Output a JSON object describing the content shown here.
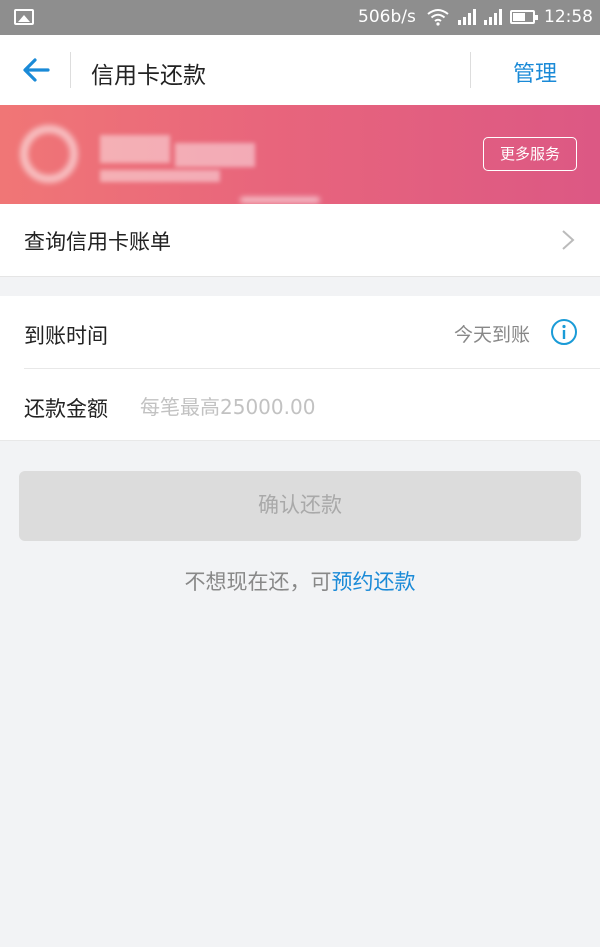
{
  "status_bar": {
    "network_speed": "506b/s",
    "time": "12:58",
    "icons": [
      "image-icon",
      "wifi-icon",
      "signal-icon",
      "signal-icon",
      "battery-icon"
    ]
  },
  "nav": {
    "title": "信用卡还款",
    "manage_label": "管理",
    "back_icon": "back-arrow-icon"
  },
  "banner": {
    "more_services_label": "更多服务",
    "gradient_colors": [
      "#f07676",
      "#dc5884"
    ]
  },
  "query_bill": {
    "label": "查询信用卡账单",
    "icon": "chevron-right-icon"
  },
  "form": {
    "arrival_time_label": "到账时间",
    "arrival_time_value": "今天到账",
    "amount_label": "还款金额",
    "amount_placeholder": "每笔最高25000.00",
    "amount_value": ""
  },
  "confirm_label": "确认还款",
  "schedule": {
    "prefix": "不想现在还，可",
    "link": "预约还款"
  },
  "colors": {
    "accent": "#1a8ad7",
    "disabled_button": "#dcdcdc",
    "background": "#f2f3f5"
  }
}
